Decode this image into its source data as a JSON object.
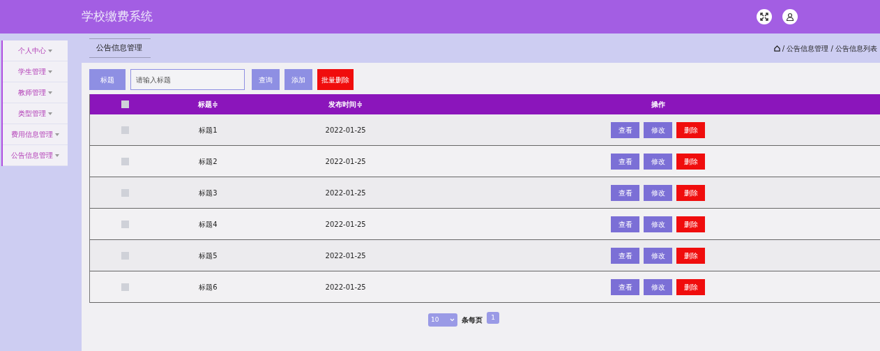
{
  "header": {
    "title": "学校缴费系统"
  },
  "sidebar": {
    "items": [
      {
        "label": "个人中心"
      },
      {
        "label": "学生管理"
      },
      {
        "label": "教师管理"
      },
      {
        "label": "类型管理"
      },
      {
        "label": "费用信息管理"
      },
      {
        "label": "公告信息管理"
      }
    ]
  },
  "page_tab": "公告信息管理",
  "breadcrumb": [
    "/ 公告信息管理 / 公告信息列表"
  ],
  "search": {
    "label": "标题",
    "placeholder": "请输入标题",
    "buttons": [
      {
        "label": "查询",
        "kind": "normal"
      },
      {
        "label": "添加",
        "kind": "normal"
      },
      {
        "label": "批量删除",
        "kind": "danger"
      }
    ]
  },
  "table": {
    "select_all": {
      "checked": false
    },
    "columns": [
      "标题≑",
      "发布时间≑",
      "操作"
    ],
    "rows": [
      {
        "checked": false,
        "title": "标题1",
        "date": "2022-01-25",
        "actions": [
          {
            "label": "查看",
            "kind": "normal"
          },
          {
            "label": "修改",
            "kind": "normal"
          },
          {
            "label": "删除",
            "kind": "danger"
          }
        ]
      },
      {
        "checked": false,
        "title": "标题2",
        "date": "2022-01-25",
        "actions": [
          {
            "label": "查看",
            "kind": "normal"
          },
          {
            "label": "修改",
            "kind": "normal"
          },
          {
            "label": "删除",
            "kind": "danger"
          }
        ]
      },
      {
        "checked": false,
        "title": "标题3",
        "date": "2022-01-25",
        "actions": [
          {
            "label": "查看",
            "kind": "normal"
          },
          {
            "label": "修改",
            "kind": "normal"
          },
          {
            "label": "删除",
            "kind": "danger"
          }
        ]
      },
      {
        "checked": false,
        "title": "标题4",
        "date": "2022-01-25",
        "actions": [
          {
            "label": "查看",
            "kind": "normal"
          },
          {
            "label": "修改",
            "kind": "normal"
          },
          {
            "label": "删除",
            "kind": "danger"
          }
        ]
      },
      {
        "checked": false,
        "title": "标题5",
        "date": "2022-01-25",
        "actions": [
          {
            "label": "查看",
            "kind": "normal"
          },
          {
            "label": "修改",
            "kind": "normal"
          },
          {
            "label": "删除",
            "kind": "danger"
          }
        ]
      },
      {
        "checked": false,
        "title": "标题6",
        "date": "2022-01-25",
        "actions": [
          {
            "label": "查看",
            "kind": "normal"
          },
          {
            "label": "修改",
            "kind": "normal"
          },
          {
            "label": "删除",
            "kind": "danger"
          }
        ]
      }
    ]
  },
  "pagination": {
    "page_size": "10",
    "page_size_label": "条每页",
    "pages": [
      {
        "label": "1",
        "selected": true
      }
    ]
  }
}
